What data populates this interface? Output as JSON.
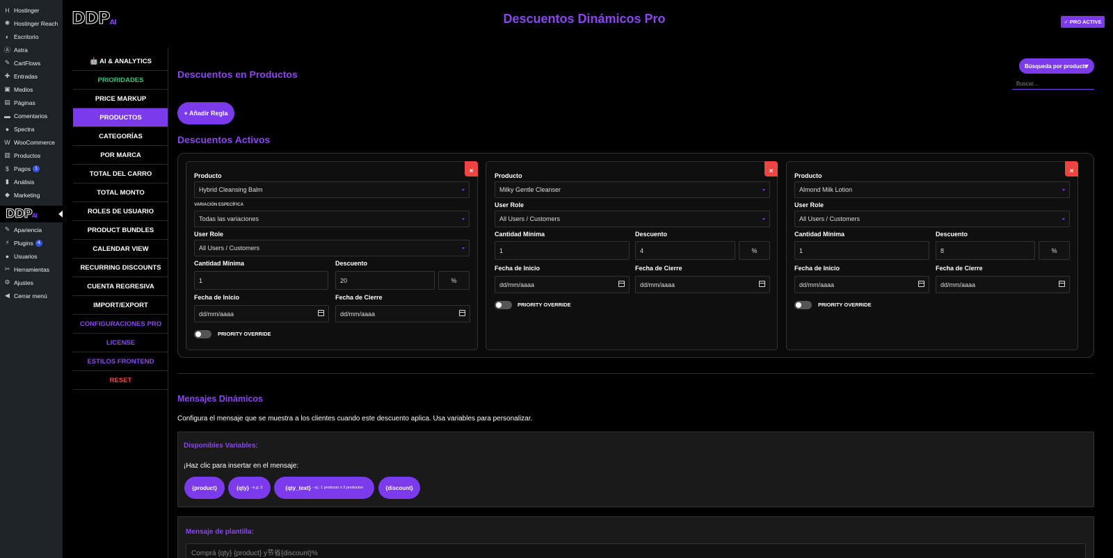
{
  "wp_menu": [
    {
      "label": "Hostinger",
      "icon": "hostinger-icon",
      "glyph": "H"
    },
    {
      "label": "Hostinger Reach",
      "icon": "reach-icon",
      "glyph": "✺"
    },
    {
      "label": "Escritorio",
      "icon": "dashboard-icon",
      "glyph": "◐"
    },
    {
      "label": "Astra",
      "icon": "astra-icon",
      "glyph": "Ⓐ"
    },
    {
      "label": "CartFlows",
      "icon": "cartflows-icon",
      "glyph": "✎"
    },
    {
      "label": "Entradas",
      "icon": "pin-icon",
      "glyph": "✚"
    },
    {
      "label": "Medios",
      "icon": "media-icon",
      "glyph": "▣"
    },
    {
      "label": "Páginas",
      "icon": "pages-icon",
      "glyph": "▤"
    },
    {
      "label": "Comentarios",
      "icon": "comments-icon",
      "glyph": "▬"
    },
    {
      "label": "Spectra",
      "icon": "spectra-icon",
      "glyph": "●"
    },
    {
      "label": "WooCommerce",
      "icon": "woocommerce-icon",
      "glyph": "W"
    },
    {
      "label": "Productos",
      "icon": "products-icon",
      "glyph": "▥"
    },
    {
      "label": "Pagos",
      "icon": "payments-icon",
      "glyph": "$",
      "badge": "1"
    },
    {
      "label": "Análisis",
      "icon": "analytics-icon",
      "glyph": "▮"
    },
    {
      "label": "Marketing",
      "icon": "marketing-icon",
      "glyph": "◆"
    },
    {
      "label": "Apariencia",
      "icon": "appearance-icon",
      "glyph": "✎"
    },
    {
      "label": "Plugins",
      "icon": "plugins-icon",
      "glyph": "⚡",
      "badge": "4"
    },
    {
      "label": "Usuarios",
      "icon": "users-icon",
      "glyph": "●"
    },
    {
      "label": "Herramientas",
      "icon": "tools-icon",
      "glyph": "✂"
    },
    {
      "label": "Ajustes",
      "icon": "settings-icon",
      "glyph": "⚙"
    },
    {
      "label": "Cerrar menú",
      "icon": "collapse-icon",
      "glyph": "◀"
    }
  ],
  "logo": {
    "ddp": "DDP",
    "ai": "AI"
  },
  "app_title": "Descuentos Dinámicos Pro",
  "pro_badge": "✓ PRO ACTIVE",
  "plugin_nav": [
    {
      "label": "🤖 AI & ANALYTICS",
      "style": ""
    },
    {
      "label": "PRIORIDADES",
      "style": "green"
    },
    {
      "label": "PRICE MARKUP",
      "style": ""
    },
    {
      "label": "PRODUCTOS",
      "style": "active"
    },
    {
      "label": "CATEGORÍAS",
      "style": ""
    },
    {
      "label": "POR MARCA",
      "style": ""
    },
    {
      "label": "TOTAL DEL CARRO",
      "style": ""
    },
    {
      "label": "TOTAL MONTO",
      "style": ""
    },
    {
      "label": "ROLES DE USUARIO",
      "style": ""
    },
    {
      "label": "PRODUCT BUNDLES",
      "style": ""
    },
    {
      "label": "CALENDAR VIEW",
      "style": ""
    },
    {
      "label": "RECURRING DISCOUNTS",
      "style": ""
    },
    {
      "label": "CUENTA REGRESIVA",
      "style": ""
    },
    {
      "label": "IMPORT/EXPORT",
      "style": ""
    },
    {
      "label": "CONFIGURACIONES PRO",
      "style": "purple"
    },
    {
      "label": "LICENSE",
      "style": "purple"
    },
    {
      "label": "ESTILOS FRONTEND",
      "style": "purple"
    },
    {
      "label": "RESET",
      "style": "red"
    }
  ],
  "products_section": {
    "title": "Descuentos en Productos",
    "search_mode": "Búsqueda por producto",
    "search_placeholder": "Buscar...",
    "add_rule": "+ Añadir Regla",
    "active_title": "Descuentos Activos"
  },
  "labels": {
    "product": "Producto",
    "variation": "VARIACIÓN ESPECÍFICA",
    "user_role": "User Role",
    "min_qty": "Cantidad Mínima",
    "discount": "Descuento",
    "start_date": "Fecha de Inicio",
    "end_date": "Fecha de Cierre",
    "priority_override": "PRIORITY OVERRIDE",
    "close": "×"
  },
  "rules": [
    {
      "product": "Hybrid Cleansing Balm",
      "variation": "Todas las variaciones",
      "user_role": "All Users / Customers",
      "min_qty": "1",
      "discount": "20",
      "unit": "%",
      "start_date": "dd/mm/aaaa",
      "end_date": "dd/mm/aaaa",
      "priority_override": false
    },
    {
      "product": "Milky Gentle Cleanser",
      "user_role": "All Users / Customers",
      "min_qty": "1",
      "discount": "4",
      "unit": "%",
      "start_date": "dd/mm/aaaa",
      "end_date": "dd/mm/aaaa",
      "priority_override": false
    },
    {
      "product": "Almond Milk Lotion",
      "user_role": "All Users / Customers",
      "min_qty": "1",
      "discount": "8",
      "unit": "%",
      "start_date": "dd/mm/aaaa",
      "end_date": "dd/mm/aaaa",
      "priority_override": false
    }
  ],
  "messages": {
    "title": "Mensajes Dinámicos",
    "description": "Configura el mensaje que se muestra a los clientes cuando este descuento aplica. Usa variables para personalizar.",
    "vars_title": "Disponibles Variables:",
    "vars_hint": "¡Haz clic para insertar en el mensaje:",
    "chips": [
      {
        "label": "{product}",
        "example": ""
      },
      {
        "label": "{qty}",
        "example": "- e.g: 3"
      },
      {
        "label": "{qty_text}",
        "example": "- ej.: 1 producto o 3 productos"
      },
      {
        "label": "{discount}",
        "example": ""
      }
    ],
    "template_label": "Mensaje de plantilla:",
    "template_value": "Comprá {qty} {product} y节省{discount}%"
  },
  "colors": {
    "accent": "#7c3aed",
    "title": "#8b46f0",
    "danger": "#ef4444",
    "success": "#3fbf7f",
    "wp_sidebar": "#1d2327"
  }
}
